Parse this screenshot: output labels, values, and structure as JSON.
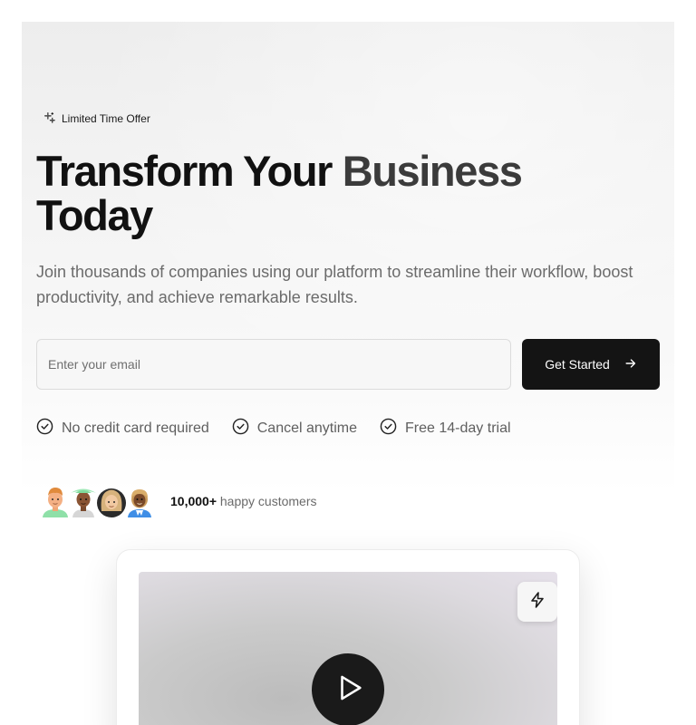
{
  "badge": {
    "label": "Limited Time Offer",
    "icon": "sparkles-icon"
  },
  "hero": {
    "headline": "Transform Your Business Today",
    "subtitle": "Join thousands of companies using our platform to streamline their workflow, boost productivity, and achieve remarkable results."
  },
  "signup": {
    "email_placeholder": "Enter your email",
    "email_value": "",
    "cta_label": "Get Started",
    "cta_icon": "arrow-right-icon"
  },
  "features": [
    {
      "label": "No credit card required",
      "icon": "check-circle-icon"
    },
    {
      "label": "Cancel anytime",
      "icon": "check-circle-icon"
    },
    {
      "label": "Free 14-day trial",
      "icon": "check-circle-icon"
    }
  ],
  "social_proof": {
    "count": "10,000+",
    "text": "happy customers",
    "avatars": [
      "avatar-1",
      "avatar-2",
      "avatar-3",
      "avatar-4"
    ]
  },
  "video": {
    "play_icon": "play-icon",
    "badge_icon": "lightning-icon"
  },
  "colors": {
    "cta_background": "#141414",
    "text_primary": "#111111",
    "text_muted": "#6b6b6b"
  }
}
